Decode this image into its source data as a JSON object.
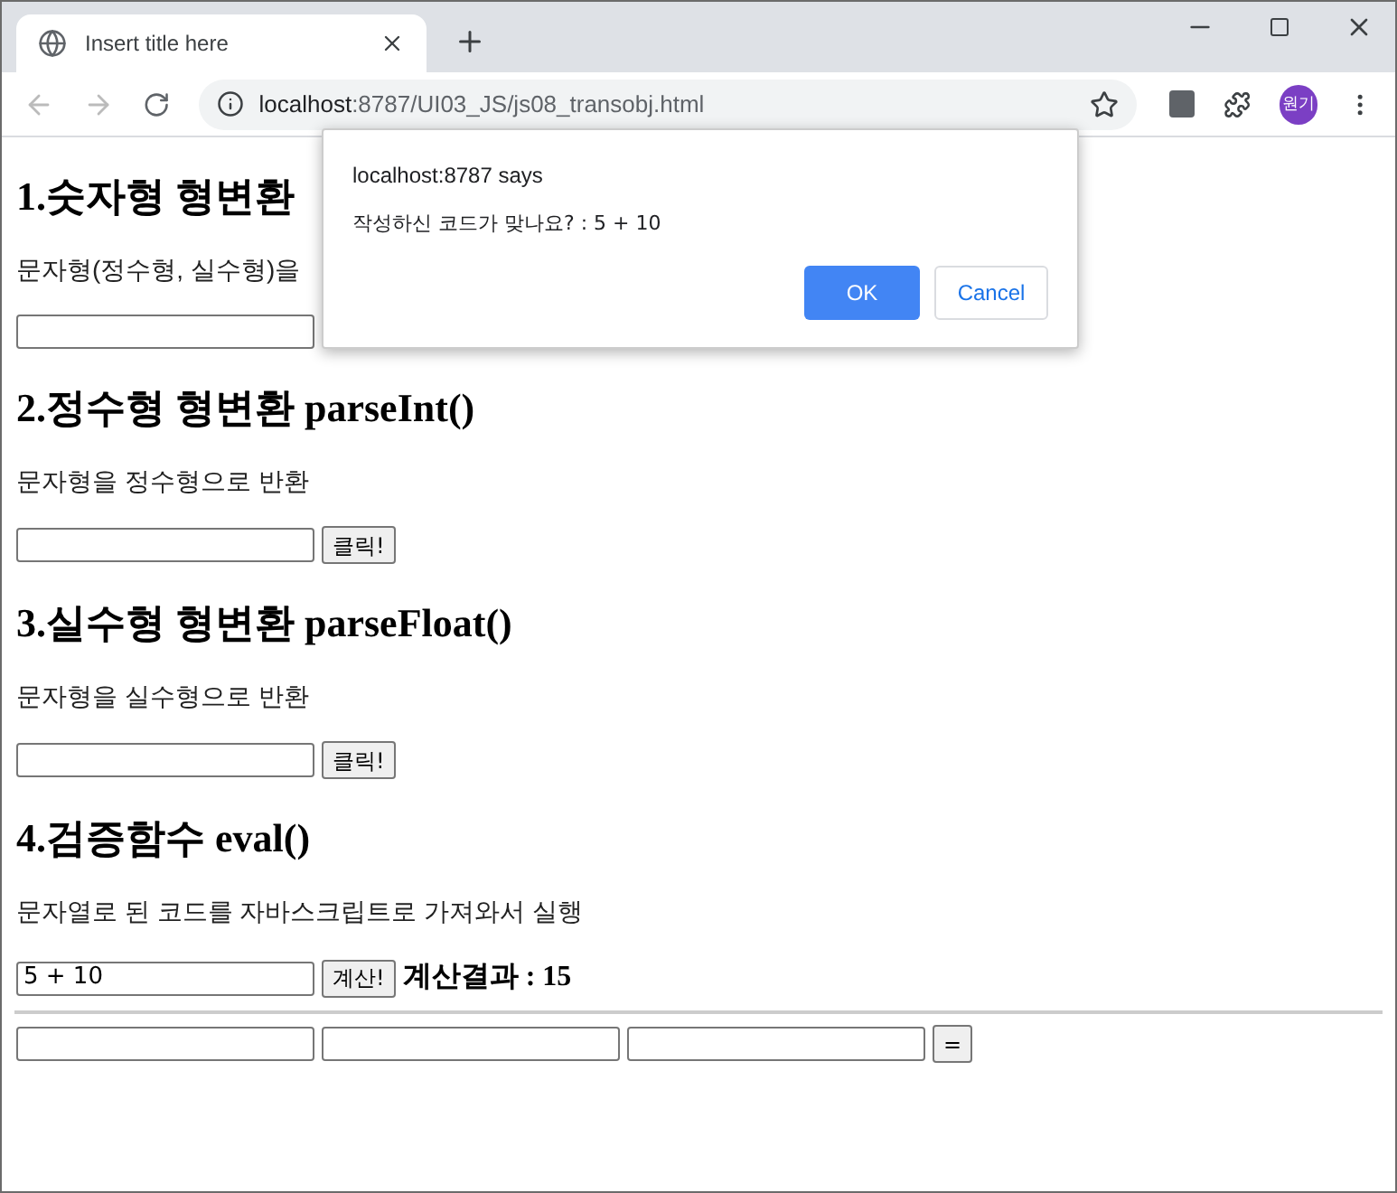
{
  "browser": {
    "tab_title": "Insert title here",
    "url_host": "localhost",
    "url_rest": ":8787/UI03_JS/js08_transobj.html",
    "profile": "원기"
  },
  "sections": [
    {
      "heading": "1.숫자형 형변환",
      "description": "문자형(정수형, 실수형)을"
    },
    {
      "heading": "2.정수형 형변환 parseInt()",
      "description": "문자형을 정수형으로 반환",
      "button": "클릭!"
    },
    {
      "heading": "3.실수형 형변환 parseFloat()",
      "description": "문자형을 실수형으로 반환",
      "button": "클릭!"
    },
    {
      "heading": "4.검증함수 eval()",
      "description": "문자열로 된 코드를 자바스크립트로 가져와서 실행",
      "value": "5 + 10",
      "button": "계산!",
      "result": "계산결과 : 15"
    }
  ],
  "calculator": {
    "button": "="
  },
  "dialog": {
    "title": "localhost:8787 says",
    "message": "작성하신 코드가 맞나요? : 5 + 10",
    "buttons": [
      {
        "label": "OK",
        "kind": "primary"
      },
      {
        "label": "Cancel",
        "kind": "secondary"
      }
    ]
  }
}
